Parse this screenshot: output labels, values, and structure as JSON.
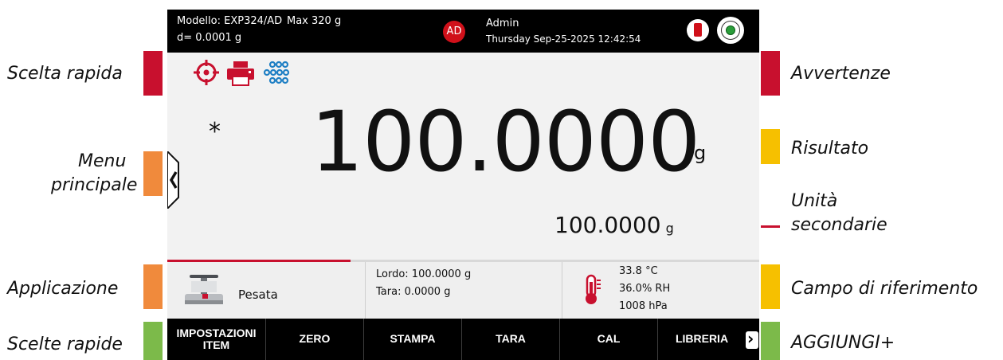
{
  "callouts": {
    "left": [
      "Scelta rapida",
      "Menu principale",
      "Applicazione",
      "Scelte rapide"
    ],
    "menu_line1": "Menu",
    "menu_line2": "principale",
    "right": [
      "Avvertenze",
      "Risultato",
      "Campo di riferimento",
      "AGGIUNGI+"
    ],
    "secondary_line1": "Unità",
    "secondary_line2": "secondarie"
  },
  "header": {
    "model": "Modello: EXP324/AD",
    "max": "Max 320 g",
    "resolution": "d= 0.0001 g",
    "user_initials": "AD",
    "user_name": "Admin",
    "datetime": "Thursday Sep-25-2025 12:42:54"
  },
  "reading": {
    "value": "100.0000",
    "unit": "g",
    "stability_marker": "*",
    "secondary_value": "100.0000",
    "secondary_unit": "g"
  },
  "application": {
    "name": "Pesata",
    "progress_fraction": 0.31
  },
  "reference": {
    "gross": "Lordo: 100.0000 g",
    "tare": "Tara: 0.0000 g",
    "temperature": "33.8 °C",
    "humidity": "36.0% RH",
    "pressure": "1008 hPa"
  },
  "softkeys": [
    "IMPOSTAZIONI ITEM",
    "ZERO",
    "STAMPA",
    "TARA",
    "CAL",
    "LIBRERIA"
  ],
  "colors": {
    "accent_red": "#c8102e",
    "orange": "#f08a3c",
    "yellow": "#f6c000",
    "green": "#7cba4a",
    "icon_blue": "#1f7fc4"
  },
  "icons": [
    "target-icon",
    "printer-icon",
    "keypad-icon",
    "usb-icon",
    "level-icon",
    "chevron-left-icon",
    "scale-icon",
    "thermometer-icon",
    "chevron-right-icon"
  ]
}
